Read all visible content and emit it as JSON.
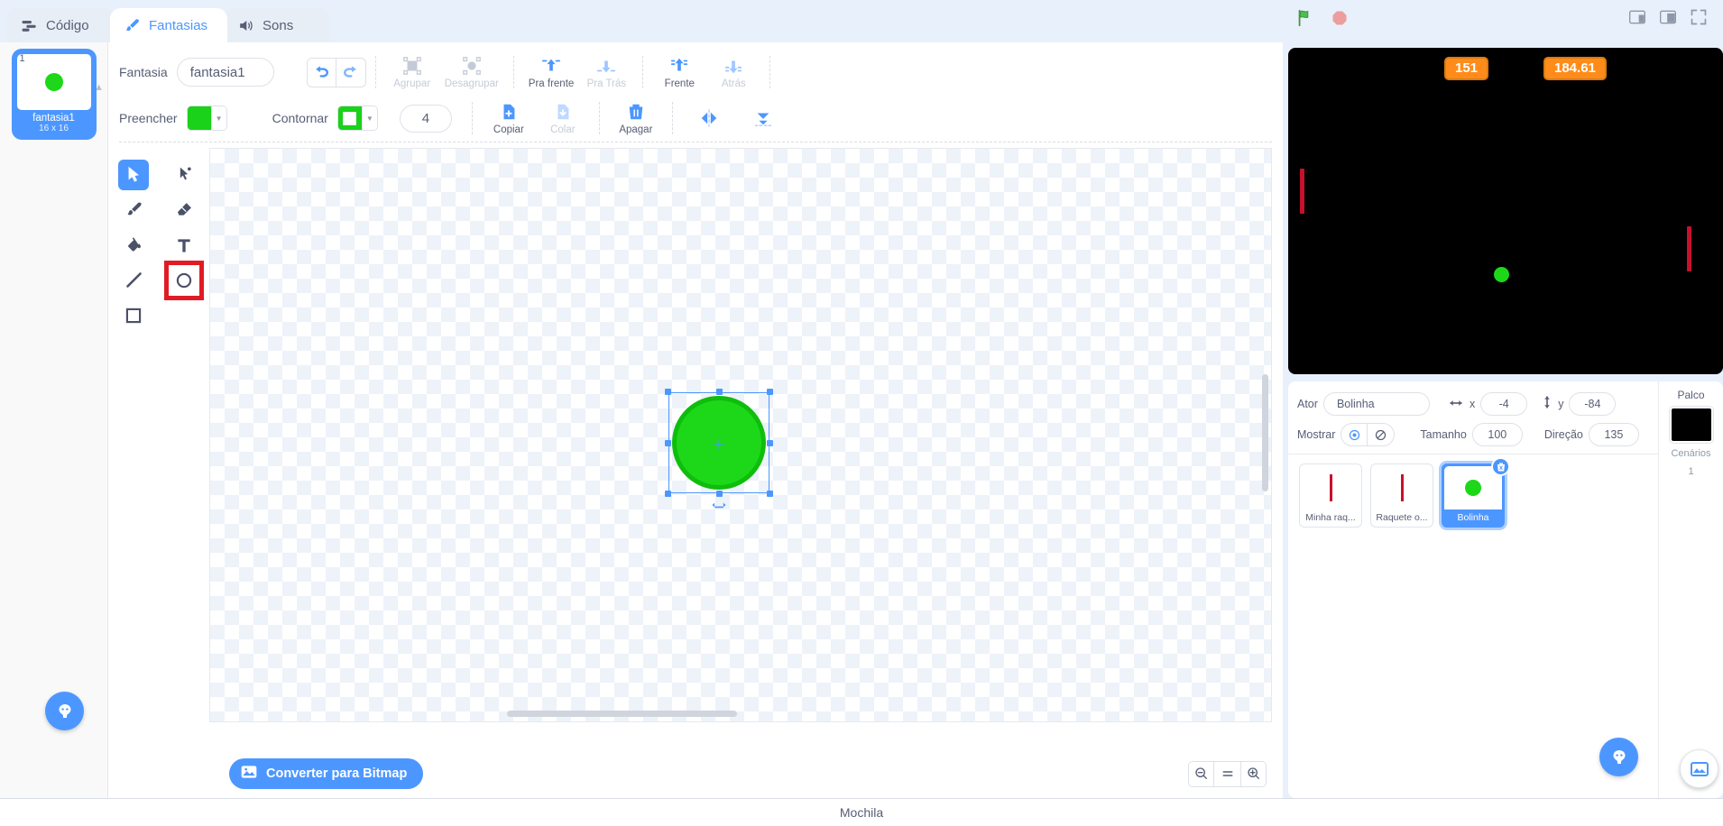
{
  "tabs": [
    {
      "label": "Código",
      "icon": "code-icon",
      "active": false
    },
    {
      "label": "Fantasias",
      "icon": "brush-icon",
      "active": true
    },
    {
      "label": "Sons",
      "icon": "speaker-icon",
      "active": false
    }
  ],
  "stage_controls": {
    "green_flag": "green-flag-icon",
    "stop": "stop-icon"
  },
  "layout_controls": [
    "small-stage-icon",
    "large-stage-icon",
    "fullscreen-icon"
  ],
  "costume_list": {
    "items": [
      {
        "number": "1",
        "name": "fantasia1",
        "size": "16 x 16",
        "selected": true
      }
    ]
  },
  "paint": {
    "costume_label": "Fantasia",
    "costume_name": "fantasia1",
    "undo_label": "undo-icon",
    "redo_label": "redo-icon",
    "group_label": "Agrupar",
    "ungroup_label": "Desagrupar",
    "forward_label": "Pra frente",
    "backward_label": "Pra Trás",
    "front_label": "Frente",
    "back_label": "Atrás",
    "fill_label": "Preencher",
    "fill_color": "#19d219",
    "outline_label": "Contornar",
    "outline_color": "#19d219",
    "stroke_width": "4",
    "copy_label": "Copiar",
    "paste_label": "Colar",
    "delete_label": "Apagar",
    "flip_horizontal": "flip-horizontal-icon",
    "flip_vertical": "flip-vertical-icon",
    "convert_button": "Converter para Bitmap",
    "zoom_out": "zoom-out-icon",
    "zoom_reset": "zoom-reset-icon",
    "zoom_in": "zoom-in-icon",
    "tools": [
      {
        "name": "select-tool",
        "active": true,
        "highlighted": false
      },
      {
        "name": "reshape-tool",
        "active": false,
        "highlighted": false
      },
      {
        "name": "brush-tool",
        "active": false,
        "highlighted": false
      },
      {
        "name": "eraser-tool",
        "active": false,
        "highlighted": false
      },
      {
        "name": "fill-tool",
        "active": false,
        "highlighted": false
      },
      {
        "name": "text-tool",
        "active": false,
        "highlighted": false
      },
      {
        "name": "line-tool",
        "active": false,
        "highlighted": false
      },
      {
        "name": "circle-tool",
        "active": false,
        "highlighted": true
      },
      {
        "name": "rectangle-tool",
        "active": false,
        "highlighted": false
      }
    ]
  },
  "stage": {
    "background_color": "#000000",
    "monitors": [
      {
        "value": "151",
        "color": "#ff8c1a"
      },
      {
        "value": "184.61",
        "color": "#ff8c1a"
      }
    ],
    "paddle_color": "#c8102e",
    "ball_color": "#1cd819"
  },
  "sprite_info": {
    "actor_label": "Ator",
    "actor_name": "Bolinha",
    "x_label": "x",
    "x_value": "-4",
    "y_label": "y",
    "y_value": "-84",
    "show_label": "Mostrar",
    "show_visible_icon": "eye-icon",
    "show_hidden_icon": "eye-slash-icon",
    "size_label": "Tamanho",
    "size_value": "100",
    "direction_label": "Direção",
    "direction_value": "135"
  },
  "sprites": [
    {
      "name": "Minha raq...",
      "type": "paddle",
      "selected": false
    },
    {
      "name": "Raquete o...",
      "type": "paddle",
      "selected": false
    },
    {
      "name": "Bolinha",
      "type": "ball",
      "selected": true
    }
  ],
  "stage_panel": {
    "title": "Palco",
    "backdrops_label": "Cenários",
    "backdrops_count": "1"
  },
  "backpack": {
    "label": "Mochila"
  },
  "fabs": {
    "costume": "add-costume-icon",
    "sprite": "add-sprite-icon",
    "stage": "add-backdrop-icon"
  }
}
